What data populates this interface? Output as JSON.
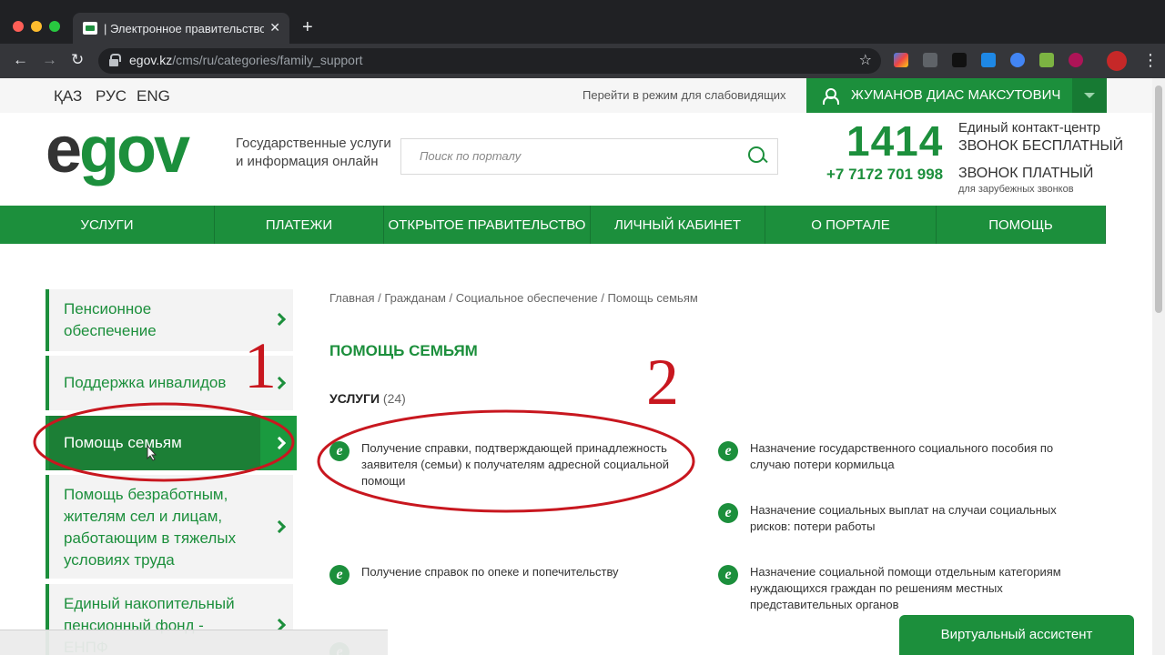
{
  "browser": {
    "tab_title": "| Электронное правительство",
    "tab_close": "✕",
    "new_tab": "+",
    "url_host": "egov.kz",
    "url_path": "/cms/ru/categories/family_support",
    "star": "☆",
    "menu": "⋮",
    "back": "←",
    "forward": "→",
    "reload": "↻"
  },
  "topbar": {
    "languages": [
      "ҚАЗ",
      "РУС",
      "ENG"
    ],
    "low_vision": "Перейти в режим для слабовидящих",
    "user_name": "ЖУМАНОВ ДИАС МАКСУТОВИЧ"
  },
  "header": {
    "logo_e": "e",
    "logo_rest": "gov",
    "tagline": "Государственные услуги\nи информация онлайн",
    "search_placeholder": "Поиск по порталу",
    "contact_number": "1414",
    "contact_label": "Единый контакт-центр",
    "free_call": "ЗВОНОК БЕСПЛАТНЫЙ",
    "phone": "+7 7172 701 998",
    "paid_call": "ЗВОНОК ПЛАТНЫЙ",
    "foreign_calls": "для зарубежных звонков"
  },
  "nav": {
    "items": [
      "Услуги",
      "Платежи",
      "Открытое правительство",
      "Личный кабинет",
      "О портале",
      "Помощь"
    ]
  },
  "sidebar": {
    "items": [
      {
        "label": "Пенсионное\nобеспечение"
      },
      {
        "label": "Поддержка инвалидов"
      },
      {
        "label": "Помощь семьям"
      },
      {
        "label": "Помощь безработным,\nжителям сел и лицам,\nработающим в тяжелых\nусловиях труда"
      },
      {
        "label": "Единый накопительный\nпенсионный фонд -\nЕНПФ"
      }
    ]
  },
  "content": {
    "breadcrumb": "Главная / Гражданам / Социальное обеспечение / Помощь семьям",
    "title": "ПОМОЩЬ СЕМЬЯМ",
    "services_label": "УСЛУГИ",
    "services_count": "(24)",
    "services": [
      "Получение справки, подтверждающей принадлежность заявителя (семьи) к получателям адресной социальной помощи",
      "Назначение государственного социального пособия по случаю потери кормильца",
      "Назначение социальных выплат на случаи социальных рисков: потери работы",
      "Получение справок по опеке и попечительству",
      "Назначение социальной помощи отдельным категориям нуждающихся граждан по решениям местных представительных органов"
    ],
    "service_icon": "e"
  },
  "annotations": {
    "num1": "1",
    "num2": "2"
  },
  "assistant": "Виртуальный ассистент",
  "colors": {
    "brand_green": "#1c8f3c",
    "annotation_red": "#c8171f"
  }
}
